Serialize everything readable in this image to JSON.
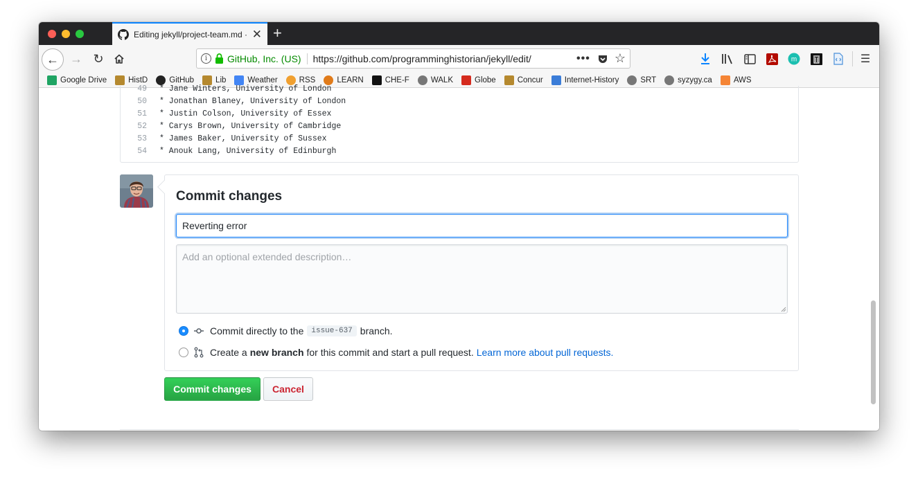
{
  "browser": {
    "tab_title": "Editing jekyll/project-team.md ·",
    "tab_close_glyph": "✕",
    "new_tab_glyph": "+",
    "identity": "GitHub, Inc. (US)",
    "url": "https://github.com/programminghistorian/jekyll/edit/",
    "url_more": "•••",
    "back_glyph": "←",
    "forward_glyph": "→",
    "reload_glyph": "↻",
    "info_glyph": "i",
    "star_glyph": "☆",
    "menu_glyph": "☰",
    "toolbar_icons": [
      "download-icon",
      "library-icon",
      "sidebar-icon",
      "pdf-icon",
      "m-extension-icon",
      "trash-extension-icon",
      "code-extension-icon",
      "menu-icon"
    ]
  },
  "bookmarks": [
    {
      "label": "Google Drive",
      "icon": "google-drive-icon",
      "color": "#1fa463"
    },
    {
      "label": "HistD",
      "icon": "shield-icon",
      "color": "#b5892f"
    },
    {
      "label": "GitHub",
      "icon": "github-icon",
      "color": "#222222"
    },
    {
      "label": "Lib",
      "icon": "shield-icon",
      "color": "#b5892f"
    },
    {
      "label": "Weather",
      "icon": "google-icon",
      "color": "#4285f4"
    },
    {
      "label": "RSS",
      "icon": "sun-icon",
      "color": "#f0a030"
    },
    {
      "label": "LEARN",
      "icon": "learn-icon",
      "color": "#e07b1a"
    },
    {
      "label": "CHE-F",
      "icon": "che-icon",
      "color": "#111111"
    },
    {
      "label": "WALK",
      "icon": "globe-icon",
      "color": "#777777"
    },
    {
      "label": "Globe",
      "icon": "maple-leaf-icon",
      "color": "#d52b1e"
    },
    {
      "label": "Concur",
      "icon": "shield-icon",
      "color": "#b5892f"
    },
    {
      "label": "Internet-History",
      "icon": "chart-icon",
      "color": "#3b7dd8"
    },
    {
      "label": "SRT",
      "icon": "globe-icon",
      "color": "#777777"
    },
    {
      "label": "syzygy.ca",
      "icon": "globe-icon",
      "color": "#777777"
    },
    {
      "label": "AWS",
      "icon": "aws-cube-icon",
      "color": "#f58536"
    }
  ],
  "code_lines": [
    {
      "num": "49",
      "text": "* Jane Winters, University of London"
    },
    {
      "num": "50",
      "text": "* Jonathan Blaney, University of London"
    },
    {
      "num": "51",
      "text": "* Justin Colson, University of Essex"
    },
    {
      "num": "52",
      "text": "* Carys Brown, University of Cambridge"
    },
    {
      "num": "53",
      "text": "* James Baker, University of Sussex"
    },
    {
      "num": "54",
      "text": "* Anouk Lang, University of Edinburgh"
    }
  ],
  "commit": {
    "heading": "Commit changes",
    "summary_value": "Reverting error",
    "description_placeholder": "Add an optional extended description…",
    "option_direct_prefix": "Commit directly to the",
    "branch_name": "issue-637",
    "option_direct_suffix": "branch.",
    "option_new_prefix": "Create a",
    "option_new_bold": "new branch",
    "option_new_suffix": "for this commit and start a pull request.",
    "learn_more_link": "Learn more about pull requests.",
    "commit_button": "Commit changes",
    "cancel_button": "Cancel"
  },
  "colors": {
    "accent": "#0a84ff",
    "identity_green": "#058b00",
    "commit_green": "#28a745",
    "cancel_red": "#cb2431",
    "link_blue": "#0366d6"
  }
}
